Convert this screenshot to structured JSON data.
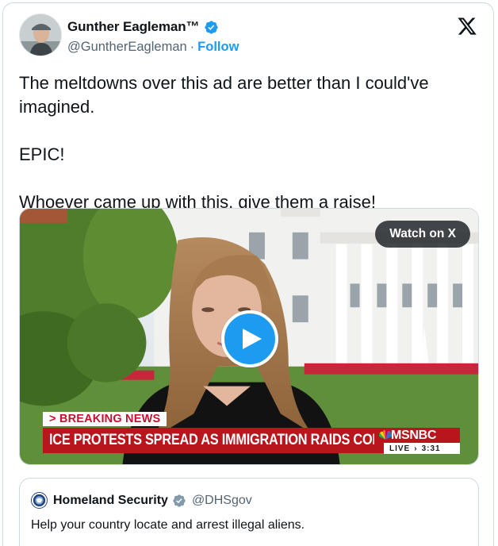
{
  "author": {
    "display_name": "Gunther Eagleman™",
    "handle": "@GuntherEagleman",
    "separator": "·",
    "follow_label": "Follow"
  },
  "tweet": {
    "text": "The meltdowns over this ad are better than I could've imagined.\n\nEPIC!\n\nWhoever came up with this, give them a raise!"
  },
  "media": {
    "watch_label": "Watch on X",
    "breaking_label": "> BREAKING NEWS",
    "headline": "ICE PROTESTS SPREAD AS IMMIGRATION RAIDS CONTINUE",
    "network": "MSNBC",
    "live_label": "LIVE",
    "time": "3:31"
  },
  "quoted": {
    "display_name": "Homeland Security",
    "handle": "@DHSgov",
    "text": "Help your country locate and arrest illegal aliens."
  },
  "icons": {
    "brand": "x-logo-icon",
    "verified": "verified-badge-icon",
    "gov_verified": "gov-verified-badge-icon",
    "play": "play-icon",
    "seal": "dhs-seal-icon"
  },
  "colors": {
    "accent": "#1d9bf0",
    "text": "#0f1419",
    "muted": "#536471",
    "border": "#cfd9de",
    "news_red": "#b8161c"
  }
}
